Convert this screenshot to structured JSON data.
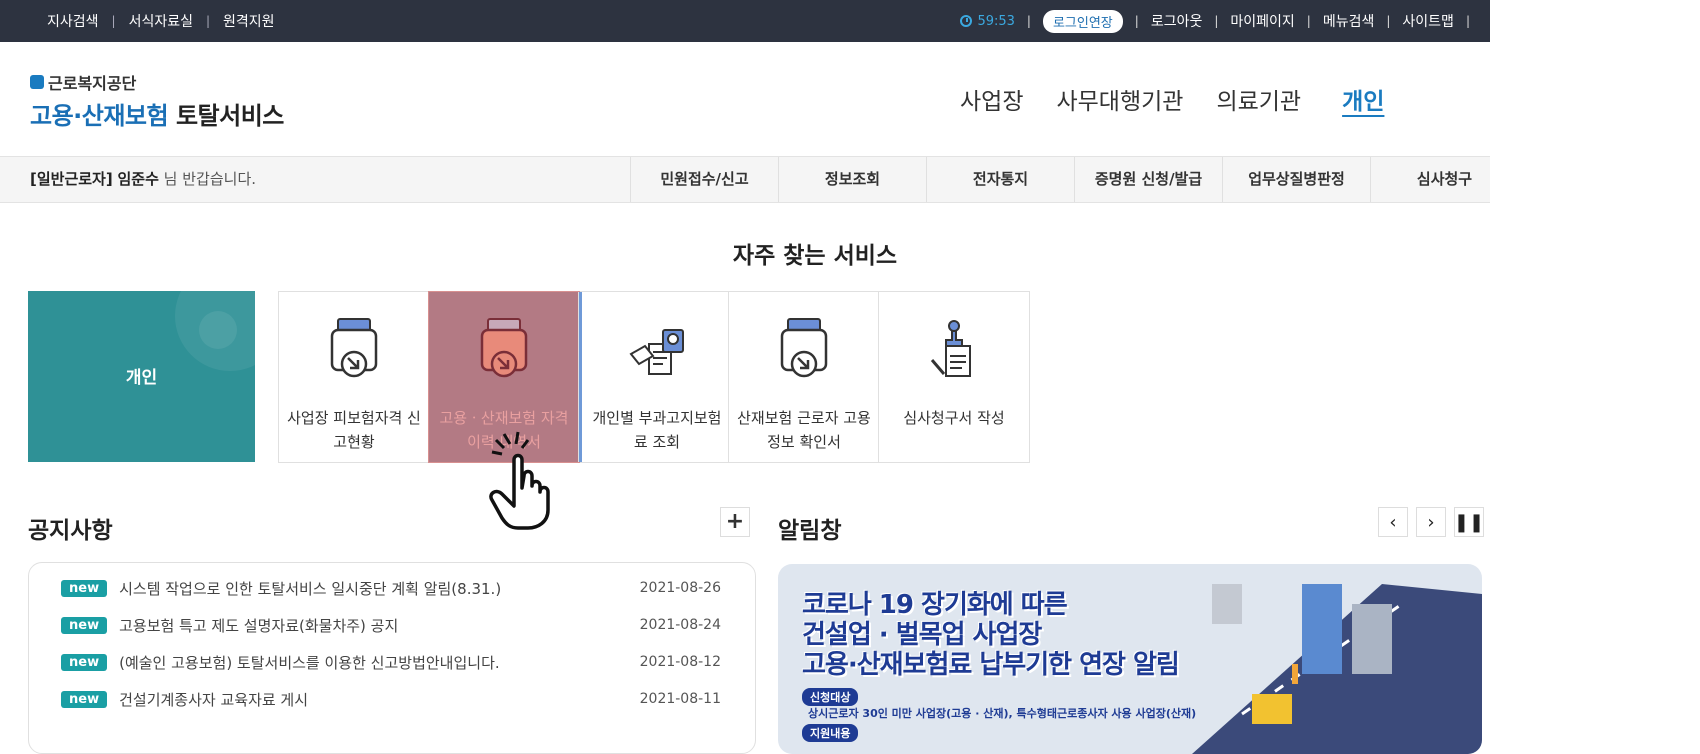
{
  "topbar": {
    "left_links": [
      "지사검색",
      "서식자료실",
      "원격지원"
    ],
    "timer": "59:53",
    "extend_button": "로그인연장",
    "right_links": [
      "로그아웃",
      "마이페이지",
      "메뉴검색",
      "사이트맵"
    ]
  },
  "header": {
    "org_name": "근로복지공단",
    "service_name_a": "고용·산재보험 ",
    "service_name_b": "토탈서비스",
    "gnb": [
      "사업장",
      "사무대행기관",
      "의료기관"
    ],
    "gnb_active": "개인"
  },
  "subnav": {
    "welcome_role": "[일반근로자]",
    "welcome_name": "임준수",
    "welcome_suffix": " 님 반갑습니다.",
    "menus": [
      "민원접수/신고",
      "정보조회",
      "전자통지",
      "증명원 신청/발급",
      "업무상질병판정",
      "심사청구"
    ]
  },
  "frequent": {
    "title": "자주 찾는 서비스",
    "category": "개인",
    "services": [
      {
        "label": "사업장 피보험자격 신고현황",
        "icon": "inbox-arrow-icon"
      },
      {
        "label": "고용ㆍ산재보험 자격 이력 내역서",
        "icon": "inbox-arrow-icon"
      },
      {
        "label": "개인별 부과고지보험료 조회",
        "icon": "document-search-icon"
      },
      {
        "label": "산재보험 근로자 고용정보 확인서",
        "icon": "inbox-arrow-icon"
      },
      {
        "label": "심사청구서 작성",
        "icon": "stamp-document-icon"
      }
    ]
  },
  "notices": {
    "title": "공지사항",
    "more": "+",
    "badge": "new",
    "items": [
      {
        "title": "시스템 작업으로 인한 토탈서비스 일시중단 계획 알림(8.31.)",
        "date": "2021-08-26"
      },
      {
        "title": "고용보험 특고 제도 설명자료(화물차주) 공지",
        "date": "2021-08-24"
      },
      {
        "title": "(예술인 고용보험) 토탈서비스를 이용한 신고방법안내입니다.",
        "date": "2021-08-12"
      },
      {
        "title": "건설기계종사자 교육자료 게시",
        "date": "2021-08-11"
      }
    ]
  },
  "alarm": {
    "title": "알림창",
    "banner_line1": "코로나 19 장기화에 따른",
    "banner_line2": "건설업 · 벌목업 사업장",
    "banner_line3": "고용·산재보험료 납부기한 연장 알림",
    "badge1": "신청대상",
    "badge1_text": "상시근로자 30인 미만 사업장(고용 · 산재), 특수형태근로종사자 사용 사업장(산재)",
    "badge2": "지원내용"
  }
}
